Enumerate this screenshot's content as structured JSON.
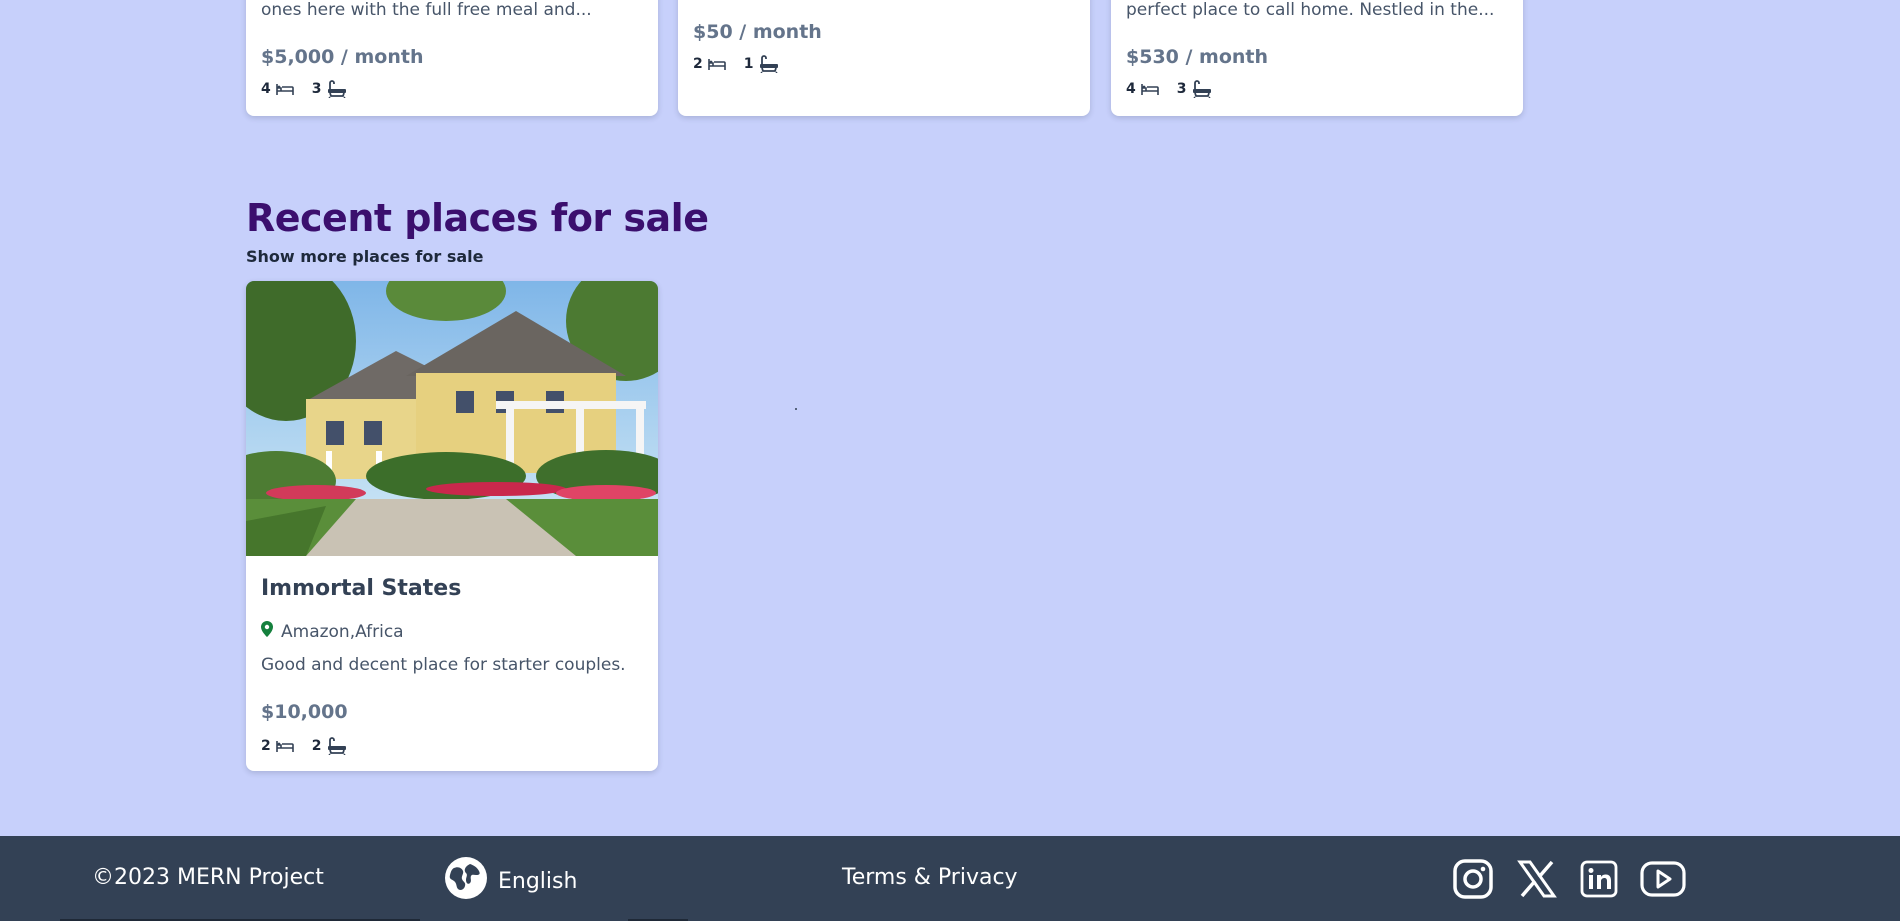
{
  "listings_top": [
    {
      "description": "ones here with the full free meal and...",
      "price": "$5,000 / month",
      "beds": "4",
      "baths": "3"
    },
    {
      "description": "",
      "price": "$50 / month",
      "beds": "2",
      "baths": "1"
    },
    {
      "description": "perfect place to call home. Nestled in the...",
      "price": "$530 / month",
      "beds": "4",
      "baths": "3"
    }
  ],
  "sale_section": {
    "title": "Recent places for sale",
    "link": "Show more places for sale",
    "listing": {
      "name": "Immortal States",
      "location": "Amazon,Africa",
      "description": "Good and decent place for starter couples.",
      "price": "$10,000",
      "beds": "2",
      "baths": "2"
    }
  },
  "footer": {
    "copyright": "©2023 MERN Project",
    "language": "English",
    "terms": "Terms & Privacy",
    "social_icons": [
      "instagram-icon",
      "x-icon",
      "linkedin-icon",
      "youtube-icon"
    ]
  },
  "colors": {
    "page_bg": "#c7d0fb",
    "heading": "#3b0f6e",
    "footer_bg": "#334155",
    "location_pin": "#15803d"
  }
}
